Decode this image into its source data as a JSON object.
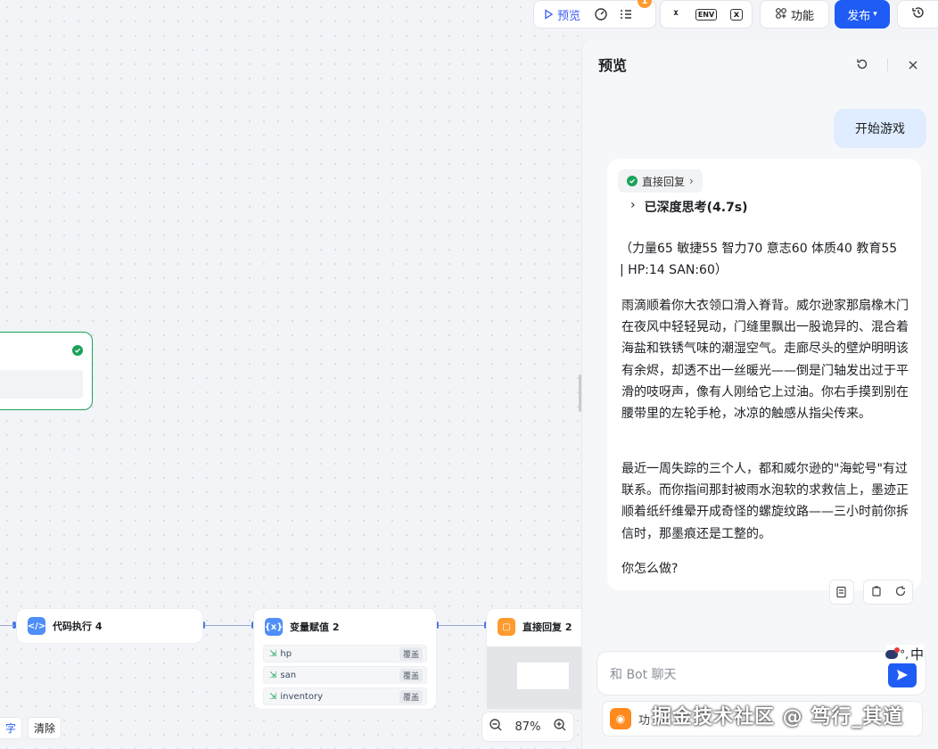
{
  "toolbar": {
    "preview_label": "预览",
    "badge_count": "1",
    "function_label": "功能",
    "publish_label": "发布",
    "env_label": "ENV"
  },
  "nodes": {
    "code": {
      "title": "代码执行 4"
    },
    "var": {
      "title": "变量赋值 2",
      "rows": [
        {
          "name": "hp",
          "tag": "覆盖"
        },
        {
          "name": "san",
          "tag": "覆盖"
        },
        {
          "name": "inventory",
          "tag": "覆盖"
        }
      ]
    },
    "reply": {
      "title": "直接回复 2"
    }
  },
  "bottom": {
    "save_label": "字",
    "clear_label": "清除",
    "zoom": "87%"
  },
  "panel": {
    "title": "预览",
    "user_message": "开始游戏",
    "reply_tag": "直接回复",
    "thinking_label": "已深度思考(4.7s)",
    "stats": "（力量65 敏捷55 智力70 意志60 体质40 教育55 | HP:14 SAN:60）",
    "para1": "雨滴顺着你大衣领口滑入脊背。威尔逊家那扇橡木门在夜风中轻轻晃动，门缝里飘出一股诡异的、混合着海盐和铁锈气味的潮湿空气。走廊尽头的壁炉明明该有余烬，却透不出一丝暖光——倒是门轴发出过于平滑的吱呀声，像有人刚给它上过油。你右手摸到别在腰带里的左轮手枪，冰凉的触感从指尖传来。",
    "para2": "最近一周失踪的三个人，都和威尔逊的\"海蛇号\"有过联系。而你指间那封被雨水泡软的求救信上，墨迹正顺着纸纤维晕开成奇怪的螺旋纹路——三小时前你拆信时，那墨痕还是工整的。",
    "question": "你怎么做?",
    "input_placeholder": "和 Bot 聊天",
    "func_label": "功",
    "ime_label": "中",
    "watermark": "掘金技术社区 @ 笃行_其道"
  },
  "colors": {
    "accent": "#1f5cf5",
    "success": "#1aa35a",
    "bubble": "#e0ecff"
  }
}
